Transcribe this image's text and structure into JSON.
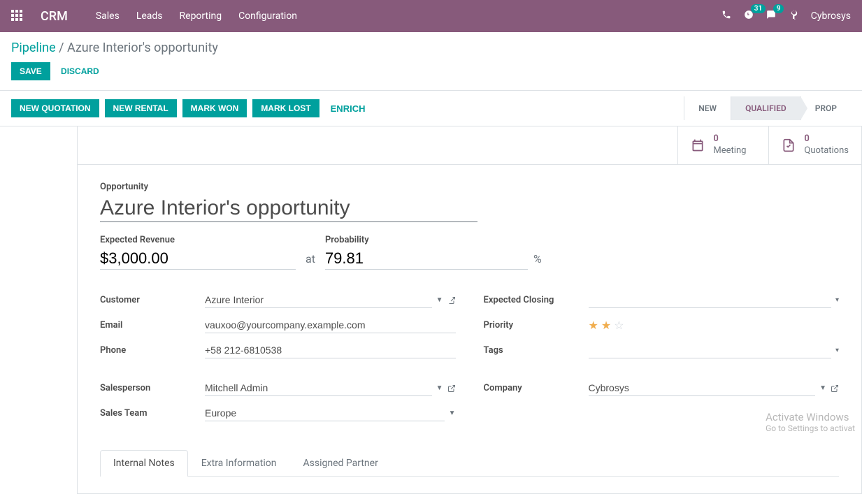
{
  "topbar": {
    "brand": "CRM",
    "nav": [
      "Sales",
      "Leads",
      "Reporting",
      "Configuration"
    ],
    "activities_badge": "31",
    "messages_badge": "9",
    "username": "Cybrosys"
  },
  "breadcrumb": {
    "root": "Pipeline",
    "current": "Azure Interior's opportunity"
  },
  "actions": {
    "save": "SAVE",
    "discard": "DISCARD"
  },
  "toolbar": {
    "new_quotation": "NEW QUOTATION",
    "new_rental": "NEW RENTAL",
    "mark_won": "MARK WON",
    "mark_lost": "MARK LOST",
    "enrich": "ENRICH"
  },
  "stages": {
    "new": "NEW",
    "qualified": "QUALIFIED",
    "proposition": "PROP"
  },
  "stat": {
    "meeting_count": "0",
    "meeting_label": "Meeting",
    "quotations_count": "0",
    "quotations_label": "Quotations"
  },
  "form": {
    "opportunity_label": "Opportunity",
    "opportunity_value": "Azure Interior's opportunity",
    "expected_revenue_label": "Expected Revenue",
    "expected_revenue_value": "$3,000.00",
    "at": "at",
    "probability_label": "Probability",
    "probability_value": "79.81",
    "pct": "%",
    "customer_label": "Customer",
    "customer_value": "Azure Interior",
    "email_label": "Email",
    "email_value": "vauxoo@yourcompany.example.com",
    "phone_label": "Phone",
    "phone_value": "+58 212-6810538",
    "salesperson_label": "Salesperson",
    "salesperson_value": "Mitchell Admin",
    "salesteam_label": "Sales Team",
    "salesteam_value": "Europe",
    "expected_closing_label": "Expected Closing",
    "expected_closing_value": "",
    "priority_label": "Priority",
    "tags_label": "Tags",
    "tags_value": "",
    "company_label": "Company",
    "company_value": "Cybrosys"
  },
  "tabs": {
    "internal_notes": "Internal Notes",
    "extra_info": "Extra Information",
    "assigned_partner": "Assigned Partner"
  },
  "watermark": {
    "line1": "Activate Windows",
    "line2": "Go to Settings to activat"
  }
}
